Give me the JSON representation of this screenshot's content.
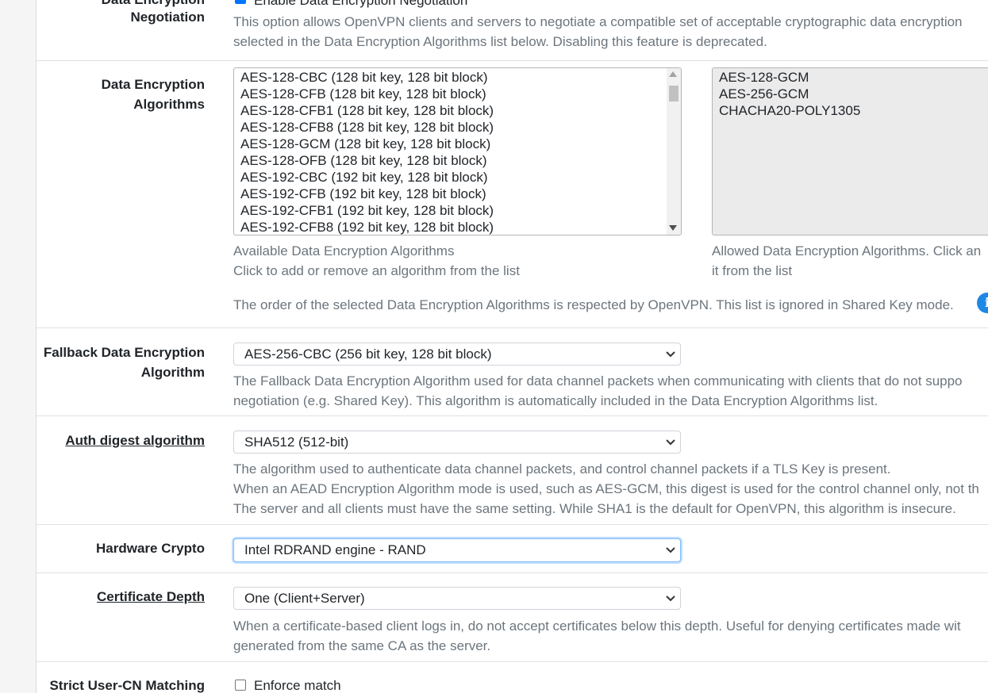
{
  "negotiation": {
    "label_top": "Data Encryption",
    "label": "Negotiation",
    "checkbox_label": "Enable Data Encryption Negotiation",
    "checked": true,
    "help": [
      "This option allows OpenVPN clients and servers to negotiate a compatible set of acceptable cryptographic data encryption",
      "selected in the Data Encryption Algorithms list below. Disabling this feature is deprecated."
    ]
  },
  "data_algorithms": {
    "label_line1": "Data Encryption",
    "label_line2": "Algorithms",
    "available": [
      "AES-128-CBC (128 bit key, 128 bit block)",
      "AES-128-CFB (128 bit key, 128 bit block)",
      "AES-128-CFB1 (128 bit key, 128 bit block)",
      "AES-128-CFB8 (128 bit key, 128 bit block)",
      "AES-128-GCM (128 bit key, 128 bit block)",
      "AES-128-OFB (128 bit key, 128 bit block)",
      "AES-192-CBC (192 bit key, 128 bit block)",
      "AES-192-CFB (192 bit key, 128 bit block)",
      "AES-192-CFB1 (192 bit key, 128 bit block)",
      "AES-192-CFB8 (192 bit key, 128 bit block)"
    ],
    "allowed": [
      "AES-128-GCM",
      "AES-256-GCM",
      "CHACHA20-POLY1305"
    ],
    "available_help_line1": "Available Data Encryption Algorithms",
    "available_help_line2": "Click to add or remove an algorithm from the list",
    "allowed_help_line1": "Allowed Data Encryption Algorithms. Click an",
    "allowed_help_line2": "it from the list",
    "order_note": "The order of the selected Data Encryption Algorithms is respected by OpenVPN. This list is ignored in Shared Key mode."
  },
  "fallback": {
    "label_line1": "Fallback Data Encryption",
    "label_line2": "Algorithm",
    "value": "AES-256-CBC (256 bit key, 128 bit block)",
    "help": [
      "The Fallback Data Encryption Algorithm used for data channel packets when communicating with clients that do not suppo",
      "negotiation (e.g. Shared Key). This algorithm is automatically included in the Data Encryption Algorithms list."
    ]
  },
  "auth_digest": {
    "label": "Auth digest algorithm",
    "value": "SHA512 (512-bit)",
    "help": [
      "The algorithm used to authenticate data channel packets, and control channel packets if a TLS Key is present.",
      "When an AEAD Encryption Algorithm mode is used, such as AES-GCM, this digest is used for the control channel only, not th",
      "The server and all clients must have the same setting. While SHA1 is the default for OpenVPN, this algorithm is insecure."
    ]
  },
  "hardware_crypto": {
    "label": "Hardware Crypto",
    "value": "Intel RDRAND engine - RAND"
  },
  "cert_depth": {
    "label": "Certificate Depth",
    "value": "One (Client+Server)",
    "help": [
      "When a certificate-based client logs in, do not accept certificates below this depth. Useful for denying certificates made wit",
      "generated from the same CA as the server."
    ]
  },
  "strict_cn": {
    "label": "Strict User-CN Matching",
    "checkbox_label": "Enforce match",
    "checked": false
  },
  "icons": {
    "chevron": "chevron-down-icon",
    "info": "info-icon",
    "info_glyph": "i"
  },
  "colors": {
    "checkbox_checked": "#0075ff",
    "focus_border": "#80bdff",
    "info_icon": "#1e88e5"
  }
}
